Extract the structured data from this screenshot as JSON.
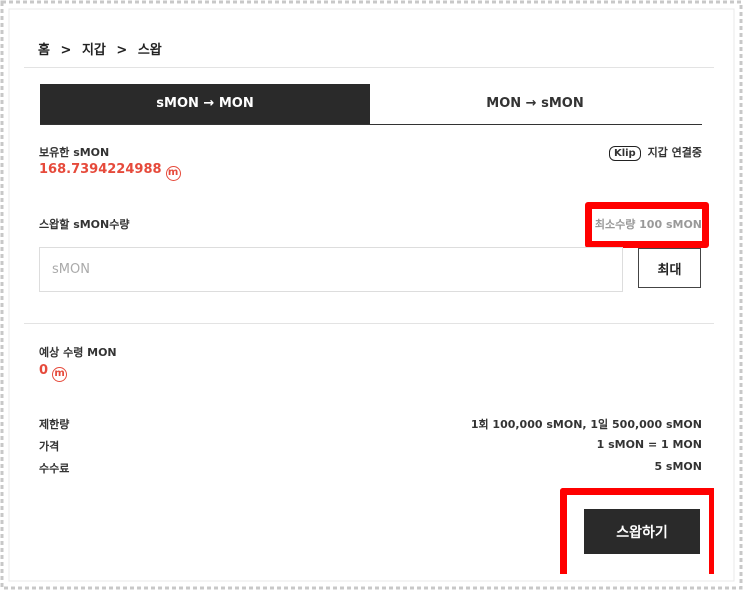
{
  "breadcrumb": [
    "홈",
    ">",
    "지갑",
    ">",
    "스왑"
  ],
  "tabs": [
    {
      "label": "sMON → MON",
      "active": true
    },
    {
      "label": "MON → sMON",
      "active": false
    }
  ],
  "balance": {
    "label": "보유한 sMON",
    "value": "168.7394224988",
    "icon": "m-coin-icon"
  },
  "wallet": {
    "logo": "Klip",
    "status": "지갑 연결중"
  },
  "swap_amount": {
    "label": "스왑할 sMON수량",
    "minimum": "최소수량 100 sMON",
    "placeholder": "sMON",
    "value": "",
    "max_label": "최대"
  },
  "expected": {
    "label": "예상 수령 MON",
    "value": "0"
  },
  "info": [
    {
      "key": "제한량",
      "value": "1회 100,000 sMON, 1일 500,000 sMON"
    },
    {
      "key": "가격",
      "value": "1 sMON = 1 MON"
    },
    {
      "key": "수수료",
      "value": "5 sMON"
    }
  ],
  "swap_button": "스왑하기",
  "colors": {
    "accent": "#e64a3b",
    "highlight": "#ff0000",
    "dark": "#2a2a2a"
  }
}
